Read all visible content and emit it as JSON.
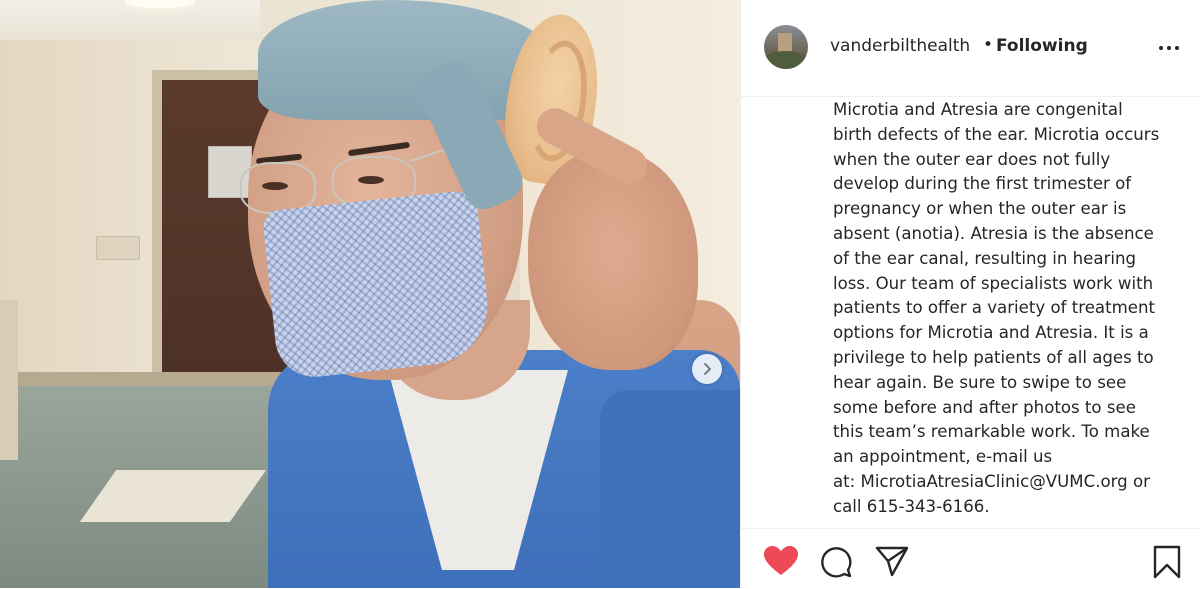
{
  "post": {
    "username": "vanderbilthealth",
    "separator": "•",
    "follow_status": "Following",
    "caption": "Microtia and Atresia are congenital\nbirth defects of the ear. Microtia occurs\nwhen the outer ear does not fully\ndevelop during the first trimester of\npregnancy or when the outer ear is\nabsent (anotia). Atresia is the absence\nof the ear canal, resulting in hearing\nloss. Our team of specialists work with\npatients to offer a variety of treatment\noptions for Microtia and Atresia. It is a\nprivilege to help patients of all ages to\nhear again. Be sure to swipe to see\nsome before and after photos to see\nthis team’s remarkable work. To make\nan appointment, e-mail us\nat: MicrotiaAtresiaClinic@VUMC.org or\ncall 615-343-6166."
  },
  "icons": {
    "more": "more-options-icon",
    "like": "heart-icon",
    "comment": "comment-icon",
    "share": "share-icon",
    "save": "bookmark-icon",
    "next": "chevron-right-icon"
  },
  "colors": {
    "like_active": "#ed4956",
    "text": "#262626",
    "border": "#efefef"
  }
}
